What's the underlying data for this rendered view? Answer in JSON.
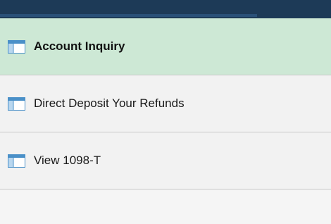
{
  "menu": {
    "items": [
      {
        "label": "Account Inquiry",
        "icon": "page-icon",
        "selected": true
      },
      {
        "label": "Direct Deposit Your Refunds",
        "icon": "page-icon",
        "selected": false
      },
      {
        "label": "View 1098-T",
        "icon": "page-icon",
        "selected": false
      }
    ]
  },
  "colors": {
    "header": "#1d3a57",
    "selected_bg": "#cde8d5",
    "item_bg": "#f2f2f2",
    "divider": "#c8c8c8",
    "icon_blue": "#4a90c8"
  }
}
